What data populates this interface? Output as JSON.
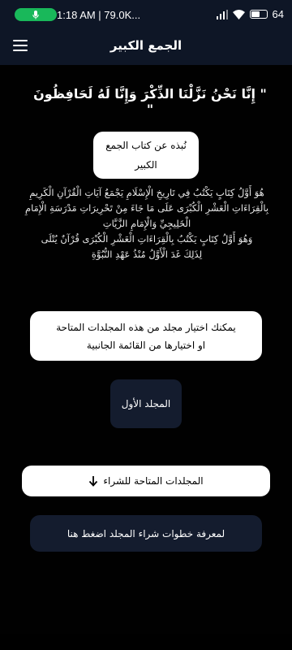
{
  "status_bar": {
    "time": "1:18 AM | 79.0K...",
    "battery": "64",
    "battery_level": 0.64
  },
  "app_bar": {
    "title": "الجمع الكبير"
  },
  "verse": "\" إِنَّا نَحْنُ نَزَّلْنَا الذِّكْرَ وَإِنَّا لَهُ لَحَافِظُونَ \"",
  "about_button": {
    "line1": "نُبذه عن كتاب الجمع",
    "line2": "الكبير"
  },
  "description": "هُوَ أَوَّلُ كِتَابٍ يَكْتُبُ فِي تَارِيخِ الْإِسْلَامِ يَجْمَعُ آيَاتِ الْقُرْآنِ الْكَرِيمِ\nبِالْقِرَاءَاتِ الْعَشْرِ الْكُبْرَى عَلَى مَا جَاءَ مِنْ تَحْرِيرَاتِ مَدْرَسَةِ الْإِمَامِ\nالْخَلِيجِيِّ وَالْإِمَامِ الزَّيَّاتِ\nوَهُوَ أَوَّلُ كِتَابٍ يَكْتُبُ بِالْقِرَاءَاتِ الْعَشْرِ الْكُبْرَى قُرْآنٌ يُتْلَى\nلِذَلِكَ غَدَ الْأَوَّلُ مُنْذُ عَهْدِ النُّبُوَّةِ",
  "info_card": "يمكنك اختيار مجلد من هذه المجلدات المتاحة\nاو اختيارها من القائمة الجانبية",
  "volume_button": "المجلد الأول",
  "buy_button": "المجلدات المتاحة للشراء",
  "steps_button": "لمعرفة خطوات شراء المجلد اضغط هنا",
  "colors": {
    "background": "#010101",
    "app_bar": "#0e1626",
    "dark_button": "#141c2e",
    "mic_pill": "#19b85a"
  }
}
